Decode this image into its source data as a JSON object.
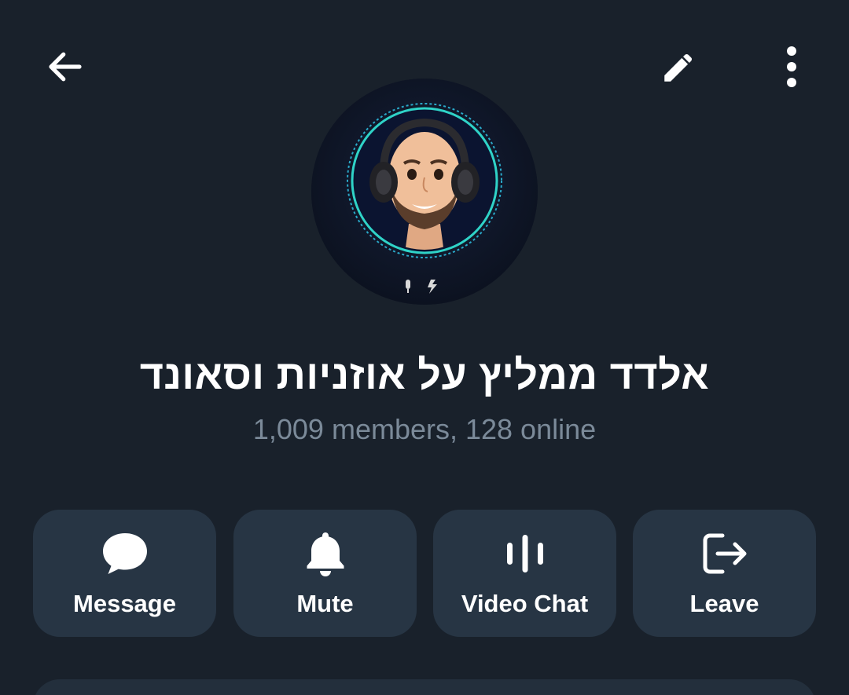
{
  "header": {
    "back_icon": "arrow-left-icon",
    "edit_icon": "pencil-icon",
    "more_icon": "more-vertical-icon"
  },
  "profile": {
    "title": "אלדד ממליץ על אוזניות וסאונד",
    "subtitle": "1,009 members, 128 online",
    "avatar_icon": "group-avatar"
  },
  "actions": [
    {
      "label": "Message",
      "icon": "chat-bubble-icon"
    },
    {
      "label": "Mute",
      "icon": "bell-icon"
    },
    {
      "label": "Video Chat",
      "icon": "voice-chat-icon"
    },
    {
      "label": "Leave",
      "icon": "leave-icon"
    }
  ],
  "colors": {
    "background": "#19212b",
    "button": "#273544",
    "subtitle": "#7b8a99",
    "text": "#ffffff"
  }
}
